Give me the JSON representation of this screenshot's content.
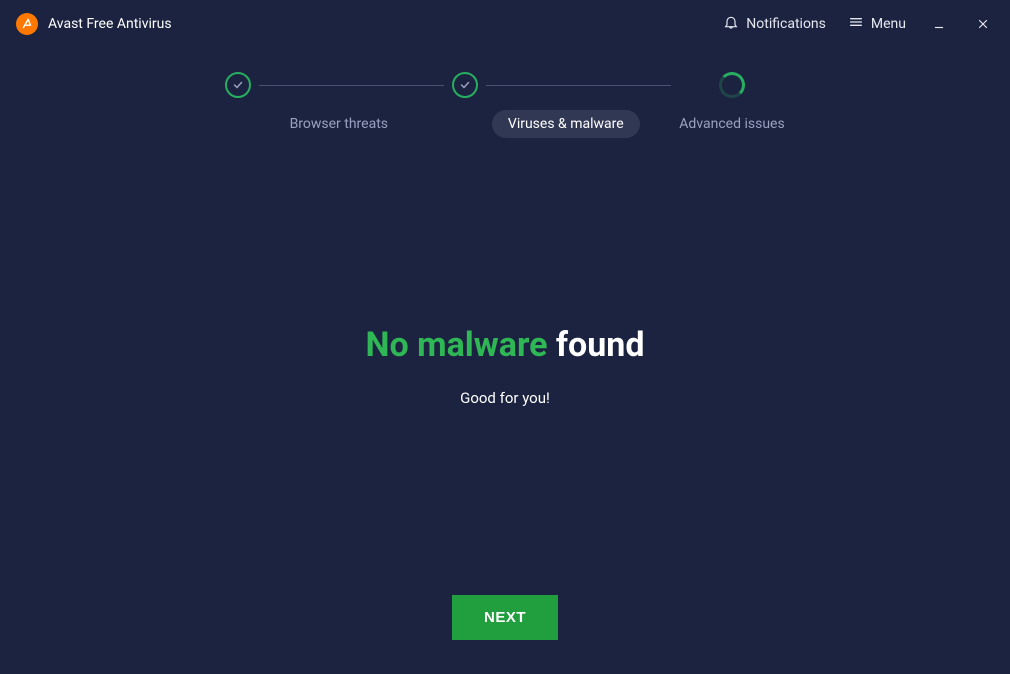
{
  "app": {
    "title": "Avast Free Antivirus"
  },
  "titlebar": {
    "notifications": "Notifications",
    "menu": "Menu"
  },
  "stepper": {
    "steps": [
      {
        "label": "Browser threats"
      },
      {
        "label": "Viruses & malware"
      },
      {
        "label": "Advanced issues"
      }
    ]
  },
  "result": {
    "headline_green": "No malware",
    "headline_rest": " found",
    "subhead": "Good for you!"
  },
  "actions": {
    "next": "NEXT"
  },
  "colors": {
    "background": "#1c2340",
    "accent_green": "#2fb756",
    "button_green": "#219e3e",
    "brand_orange": "#ff7800"
  }
}
